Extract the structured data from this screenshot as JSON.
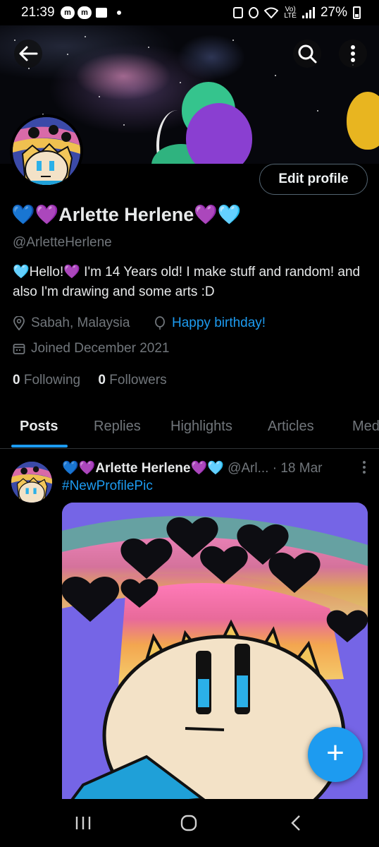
{
  "status_bar": {
    "time": "21:39",
    "battery": "27%",
    "network": "LTE"
  },
  "header": {
    "back_icon": "arrow-left-icon",
    "search_icon": "search-icon",
    "more_icon": "more-vertical-icon"
  },
  "profile": {
    "edit_label": "Edit profile",
    "name": "💙💜Arlette Herlene💜🩵",
    "handle": "@ArletteHerlene",
    "bio": "🩵Hello!💜 I'm 14 Years old! I make stuff and random! and also I'm drawing and some arts :D",
    "location": "Sabah, Malaysia",
    "birthday": "Happy birthday!",
    "joined": "Joined December 2021",
    "following_count": "0",
    "following_label": "Following",
    "followers_count": "0",
    "followers_label": "Followers"
  },
  "tabs": [
    {
      "label": "Posts",
      "active": true
    },
    {
      "label": "Replies"
    },
    {
      "label": "Highlights"
    },
    {
      "label": "Articles"
    },
    {
      "label": "Media"
    }
  ],
  "post": {
    "author": "💙💜Arlette Herlene💜🩵",
    "handle": "@Arl...",
    "date": "· 18 Mar",
    "hashtag": "#NewProfilePic"
  },
  "fab_label": "+",
  "colors": {
    "accent": "#1d9bf0",
    "muted": "#71767b",
    "background": "#000000",
    "text": "#e7e9ea"
  }
}
